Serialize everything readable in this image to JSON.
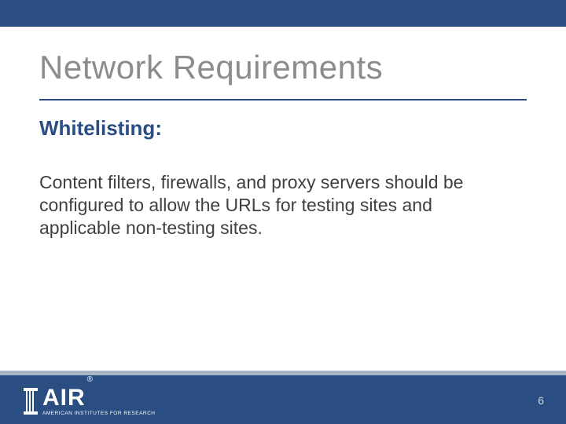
{
  "title": "Network Requirements",
  "subheading": "Whitelisting:",
  "body": "Content filters, firewalls, and proxy servers should be configured to allow the URLs for testing sites and applicable non-testing sites.",
  "page_number": "6",
  "logo": {
    "main": "AIR",
    "registered": "®",
    "subtitle": "AMERICAN INSTITUTES FOR RESEARCH"
  },
  "colors": {
    "brand_blue": "#2a4e82",
    "title_gray": "#8a8d8f",
    "body_gray": "#404040",
    "divider": "#a7b4c4"
  }
}
